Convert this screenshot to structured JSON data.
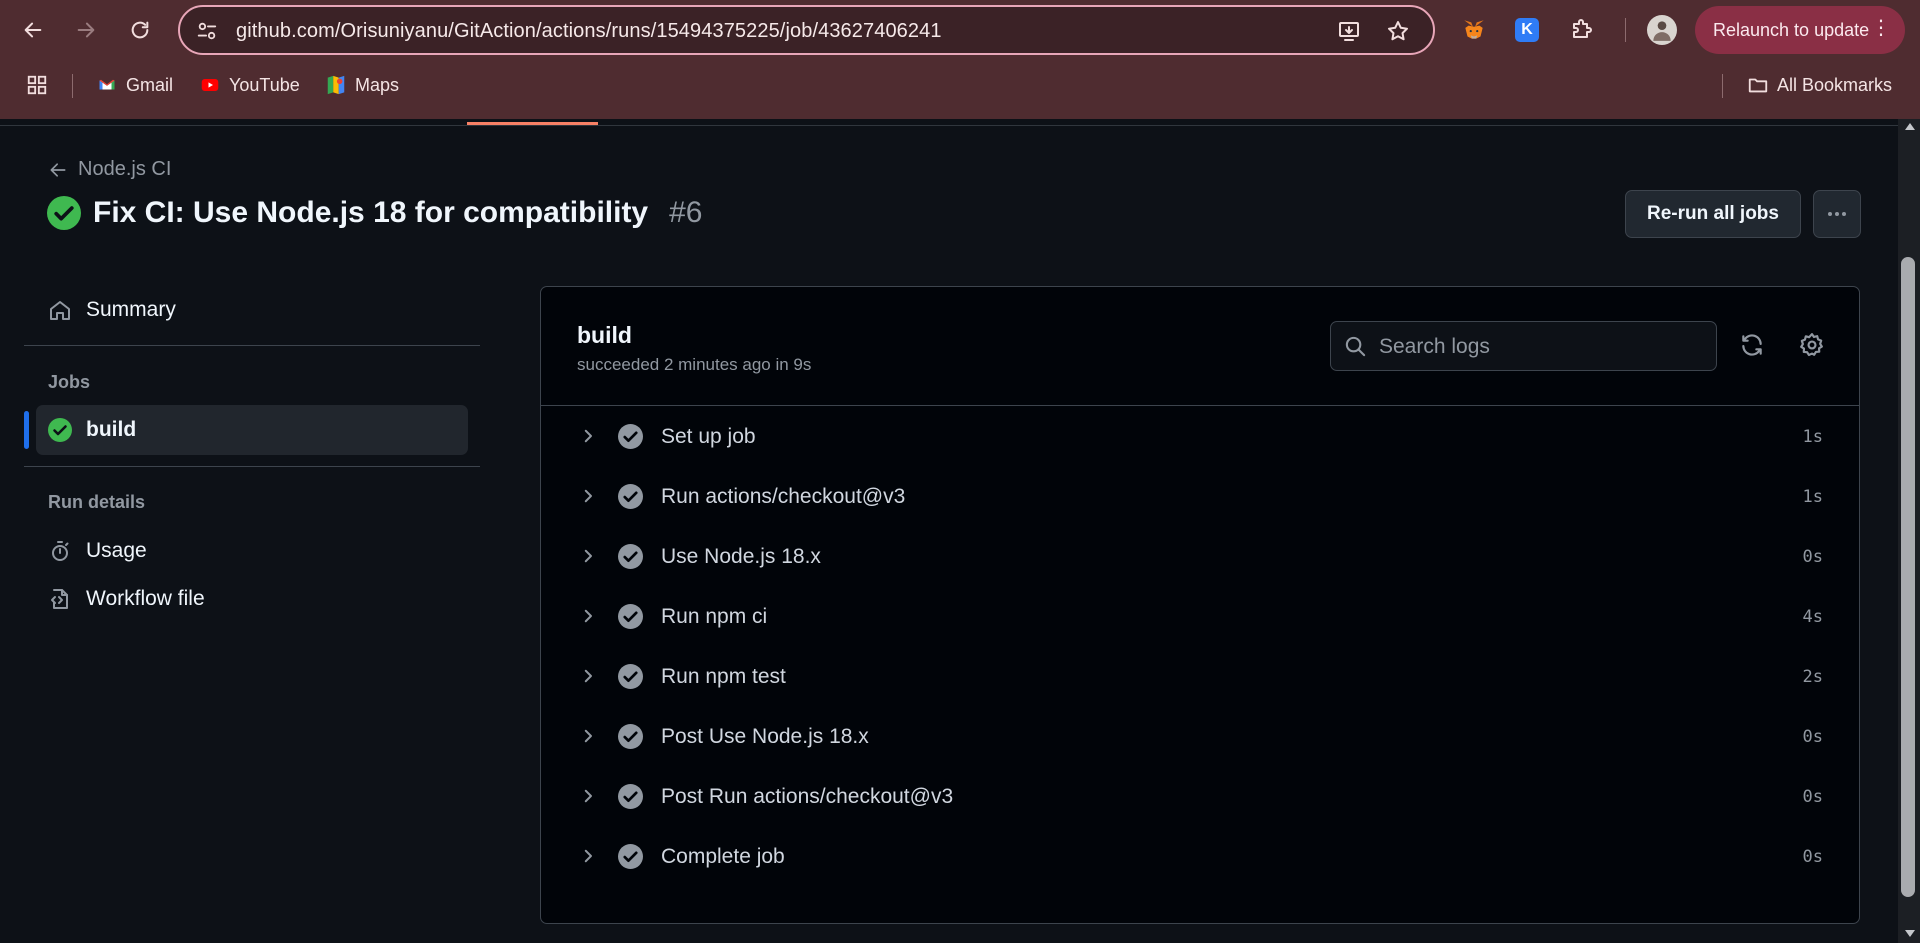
{
  "browser": {
    "url": "github.com/Orisuniyanu/GitAction/actions/runs/15494375225/job/43627406241",
    "relaunch_label": "Relaunch to update",
    "bookmarks": [
      {
        "label": "Gmail",
        "icon": "gmail-icon"
      },
      {
        "label": "YouTube",
        "icon": "youtube-icon"
      },
      {
        "label": "Maps",
        "icon": "maps-icon"
      }
    ],
    "all_bookmarks_label": "All Bookmarks",
    "extension_k_label": "K"
  },
  "header": {
    "back_label": "Node.js CI",
    "title": "Fix CI: Use Node.js 18 for compatibility",
    "run_number": "#6",
    "rerun_label": "Re-run all jobs"
  },
  "sidebar": {
    "summary_label": "Summary",
    "jobs_heading": "Jobs",
    "job_name": "build",
    "run_details_heading": "Run details",
    "usage_label": "Usage",
    "workflow_file_label": "Workflow file"
  },
  "job": {
    "title": "build",
    "status": "succeeded 2 minutes ago in 9s",
    "search_placeholder": "Search logs",
    "steps": [
      {
        "name": "Set up job",
        "time": "1s"
      },
      {
        "name": "Run actions/checkout@v3",
        "time": "1s"
      },
      {
        "name": "Use Node.js 18.x",
        "time": "0s"
      },
      {
        "name": "Run npm ci",
        "time": "4s"
      },
      {
        "name": "Run npm test",
        "time": "2s"
      },
      {
        "name": "Post Use Node.js 18.x",
        "time": "0s"
      },
      {
        "name": "Post Run actions/checkout@v3",
        "time": "0s"
      },
      {
        "name": "Complete job",
        "time": "0s"
      }
    ]
  },
  "colors": {
    "success": "#3fb950",
    "step_check": "#9198a1",
    "accent_blue": "#1f6feb",
    "chrome_bg": "#4f2c30"
  }
}
